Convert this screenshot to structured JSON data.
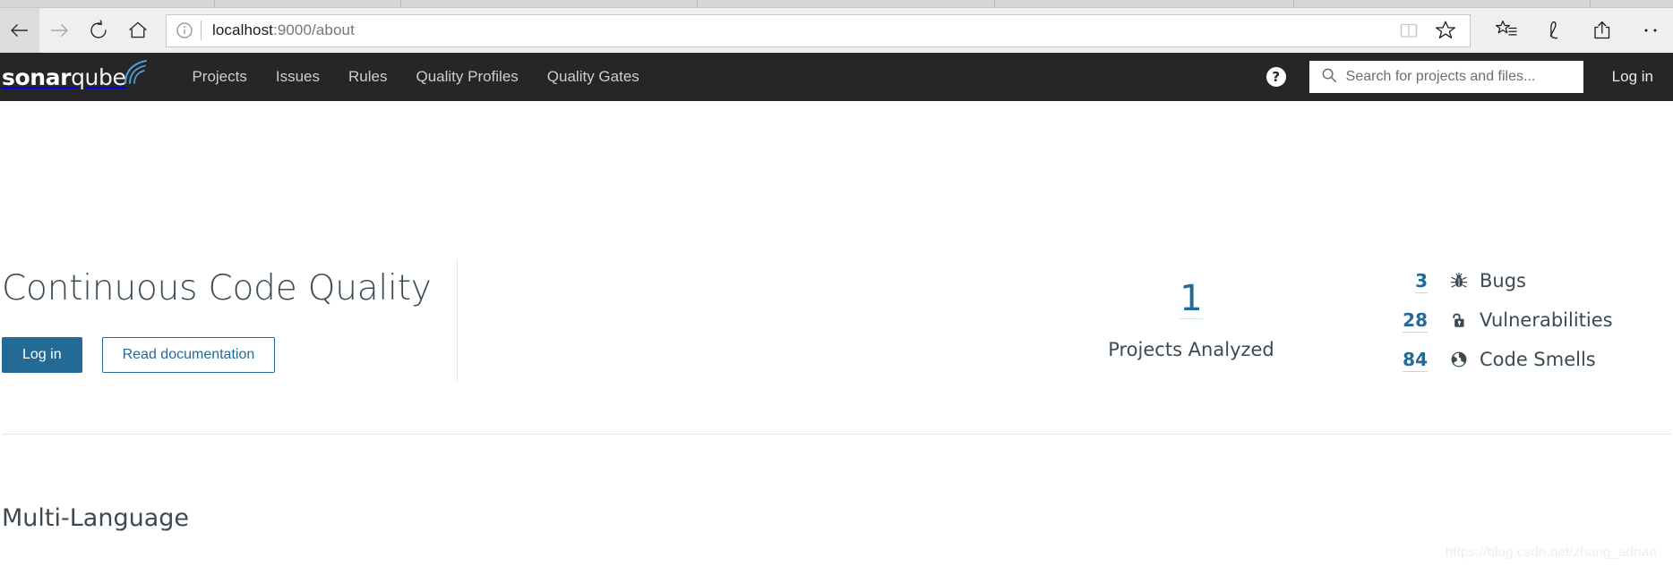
{
  "browser": {
    "back_label": "Back",
    "forward_label": "Forward",
    "refresh_label": "Refresh",
    "home_label": "Home",
    "url_prefix": "localhost",
    "url_suffix": ":9000/about",
    "url_full": "localhost:9000/about",
    "site_info_label": "Site information",
    "reading_view_label": "Reading view",
    "favorite_label": "Add to favorites",
    "hub_label": "Favorites, reading list, books, history",
    "notes_label": "Make a Web Note",
    "share_label": "Share",
    "more_label": "Settings and more"
  },
  "sq_header": {
    "logo_bold": "sonar",
    "logo_light": "qube",
    "nav": [
      {
        "label": "Projects"
      },
      {
        "label": "Issues"
      },
      {
        "label": "Rules"
      },
      {
        "label": "Quality Profiles"
      },
      {
        "label": "Quality Gates"
      }
    ],
    "help_glyph": "?",
    "search_placeholder": "Search for projects and files...",
    "search_value": "",
    "login_label": "Log in"
  },
  "hero": {
    "title": "Continuous Code Quality",
    "primary_button": "Log in",
    "secondary_button": "Read documentation",
    "projects_count": "1",
    "projects_label": "Projects Analyzed",
    "metrics": [
      {
        "value": "3",
        "label": "Bugs",
        "icon": "bug-icon"
      },
      {
        "value": "28",
        "label": "Vulnerabilities",
        "icon": "open-padlock-icon"
      },
      {
        "value": "84",
        "label": "Code Smells",
        "icon": "code-smell-icon"
      }
    ]
  },
  "feature": {
    "title": "Multi-Language"
  },
  "watermark": {
    "text": "https://blog.csdn.net/zhang_adrian"
  },
  "colors": {
    "sq_dark": "#262626",
    "accent_blue": "#236a97",
    "text_dark": "#3c4a54",
    "chrome_gray": "#efefef"
  }
}
